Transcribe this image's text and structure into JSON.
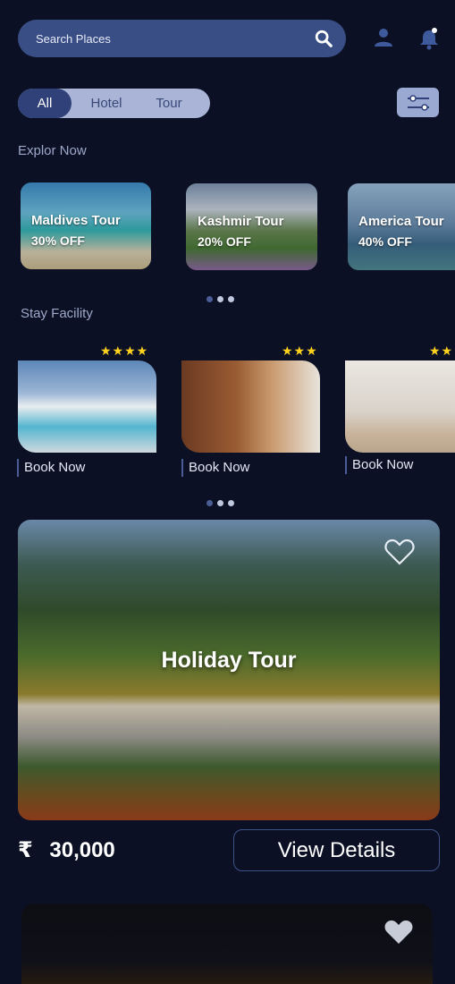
{
  "search": {
    "placeholder": "Search Places"
  },
  "icons": {
    "search": "search-icon",
    "user": "user-icon",
    "bell": "bell-icon",
    "filter": "filter-icon",
    "heart": "heart-icon",
    "rupee": "rupee-icon"
  },
  "segments": {
    "all": "All",
    "hotel": "Hotel",
    "tour": "Tour"
  },
  "explore": {
    "title": "Explor Now",
    "cards": [
      {
        "name": "Maldives Tour",
        "offer": "30% OFF"
      },
      {
        "name": "Kashmir Tour",
        "offer": "20% OFF"
      },
      {
        "name": "America Tour",
        "offer": "40% OFF"
      }
    ]
  },
  "stay": {
    "title": "Stay Facility",
    "cards": [
      {
        "stars": "★★★★",
        "rating": 4,
        "button": "Book Now"
      },
      {
        "stars": "★★★",
        "rating": 3,
        "button": "Book Now"
      },
      {
        "stars": "★★",
        "rating": 2,
        "button": "Book Now"
      }
    ]
  },
  "holiday": {
    "title": "Holiday Tour",
    "currency": "₹",
    "price": "30,000",
    "button": "View Details"
  },
  "colors": {
    "background": "#0b1024",
    "accent": "#3a4e86",
    "star": "#ffd21e"
  }
}
